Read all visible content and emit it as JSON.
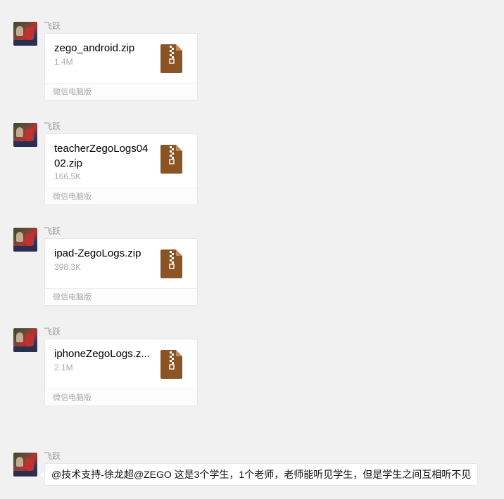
{
  "messages": [
    {
      "sender": "飞跃",
      "file_name": "zego_android.zip",
      "file_size": "1.4M",
      "source": "微信电脑版",
      "icon": "zip-file-icon"
    },
    {
      "sender": "飞跃",
      "file_name": "teacherZegoLogs0402.zip",
      "file_size": "166.5K",
      "source": "微信电脑版",
      "icon": "zip-file-icon"
    },
    {
      "sender": "飞跃",
      "file_name": "ipad-ZegoLogs.zip",
      "file_size": "398.3K",
      "source": "微信电脑版",
      "icon": "zip-file-icon"
    },
    {
      "sender": "飞跃",
      "file_name": "iphoneZegoLogs.z...",
      "file_size": "2.1M",
      "source": "微信电脑版",
      "icon": "zip-file-icon"
    },
    {
      "sender": "飞跃",
      "text": "@技术支持-徐龙超@ZEGO 这是3个学生，1个老师，老师能听见学生，但是学生之间互相听不见"
    }
  ],
  "colors": {
    "background": "#f1f1f1",
    "zip_icon": "#8b5424",
    "bubble": "#ffffff"
  }
}
